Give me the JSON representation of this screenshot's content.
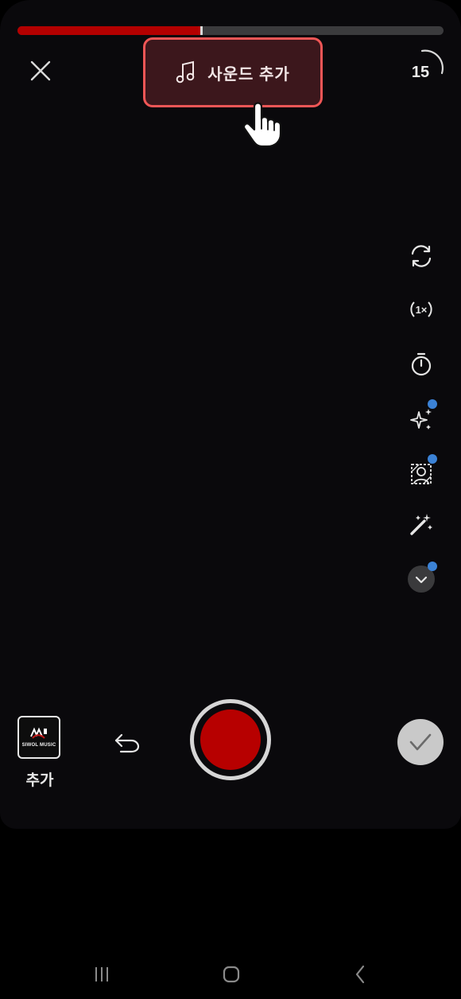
{
  "recording": {
    "progress_percent": 43
  },
  "toolbar": {
    "close_icon": "close-icon",
    "sound_label": "사운드 추가",
    "sound_icon": "music-note-icon",
    "duration_label": "15"
  },
  "side_tools": [
    {
      "name": "flip-camera-icon",
      "has_dot": false
    },
    {
      "name": "speed-1x-icon",
      "has_dot": false
    },
    {
      "name": "timer-icon",
      "has_dot": false
    },
    {
      "name": "sparkle-effects-icon",
      "has_dot": true
    },
    {
      "name": "green-screen-icon",
      "has_dot": true
    },
    {
      "name": "magic-wand-icon",
      "has_dot": false
    },
    {
      "name": "more-chevron-down-icon",
      "has_dot": true
    }
  ],
  "bottom": {
    "gallery_logo_text": "SIWOL MUSIC",
    "gallery_label": "추가",
    "undo_icon": "undo-icon",
    "confirm_icon": "check-icon"
  },
  "colors": {
    "accent_red": "#b70000",
    "sound_border": "#f05656",
    "notification_dot": "#3b82d6"
  }
}
